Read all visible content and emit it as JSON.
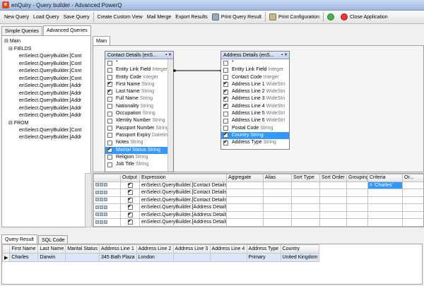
{
  "window": {
    "title": "enQuiry - Query builder - Advanced PowerQ"
  },
  "toolbar": {
    "new_query": "New Query",
    "load_query": "Load Query",
    "save_query": "Save Query",
    "create_custom_view": "Create Custom View",
    "mail_merge": "Mail Merge",
    "export_results": "Export Results",
    "print_query_result": "Print Query Result",
    "print_configuration": "Print Configuration",
    "close_application": "Close Application"
  },
  "tabs": {
    "simple": "Simple Queries",
    "advanced": "Advanced Queries",
    "main": "Main"
  },
  "tree": {
    "root": "Main",
    "fields": "FIELDS",
    "field_items": [
      "enSelect.QueryBuilder.[Cont",
      "enSelect.QueryBuilder.[Cont",
      "enSelect.QueryBuilder.[Cont",
      "enSelect.QueryBuilder.[Cont",
      "enSelect.QueryBuilder.[Addr",
      "enSelect.QueryBuilder.[Addr",
      "enSelect.QueryBuilder.[Addr",
      "enSelect.QueryBuilder.[Addr",
      "enSelect.QueryBuilder.[Addr"
    ],
    "from": "FROM",
    "from_items": [
      "enSelect.QueryBuilder.[Cont",
      "enSelect.QueryBuilder.[Addr"
    ]
  },
  "contact_box": {
    "title": "Contact Details (enS...",
    "rows": [
      {
        "name": "*",
        "type": "",
        "checked": false,
        "selected": false
      },
      {
        "name": "Entity Link Field",
        "type": "Integer",
        "checked": false,
        "selected": false
      },
      {
        "name": "Entity Code",
        "type": "Integer",
        "checked": false,
        "selected": false
      },
      {
        "name": "First Name",
        "type": "String",
        "checked": true,
        "selected": false
      },
      {
        "name": "Last Name",
        "type": "String",
        "checked": true,
        "selected": false
      },
      {
        "name": "Full Name",
        "type": "String",
        "checked": false,
        "selected": false
      },
      {
        "name": "Nationality",
        "type": "String",
        "checked": false,
        "selected": false
      },
      {
        "name": "Occupation",
        "type": "String",
        "checked": false,
        "selected": false
      },
      {
        "name": "Identity Number",
        "type": "String",
        "checked": false,
        "selected": false
      },
      {
        "name": "Passport Number",
        "type": "String",
        "checked": false,
        "selected": false
      },
      {
        "name": "Passport Expiry",
        "type": "Datetime",
        "checked": false,
        "selected": false
      },
      {
        "name": "Notes",
        "type": "String",
        "checked": false,
        "selected": false
      },
      {
        "name": "Marital Status",
        "type": "String",
        "checked": true,
        "selected": true
      },
      {
        "name": "Religion",
        "type": "String",
        "checked": false,
        "selected": false
      },
      {
        "name": "Job Title",
        "type": "String",
        "checked": false,
        "selected": false
      }
    ]
  },
  "address_box": {
    "title": "Address Details (enS...",
    "rows": [
      {
        "name": "*",
        "type": "",
        "checked": false,
        "selected": false
      },
      {
        "name": "Entity Link Field",
        "type": "Integer",
        "checked": false,
        "selected": false
      },
      {
        "name": "Contact Code",
        "type": "Integer",
        "checked": false,
        "selected": false
      },
      {
        "name": "Address Line 1",
        "type": "WideStri",
        "checked": true,
        "selected": false
      },
      {
        "name": "Address Line 2",
        "type": "WideStri",
        "checked": true,
        "selected": false
      },
      {
        "name": "Address Line 3",
        "type": "WideStri",
        "checked": true,
        "selected": false
      },
      {
        "name": "Address Line 4",
        "type": "WideStri",
        "checked": true,
        "selected": false
      },
      {
        "name": "Address Line 5",
        "type": "WideStri",
        "checked": false,
        "selected": false
      },
      {
        "name": "Address Line 6",
        "type": "WideStri",
        "checked": false,
        "selected": false
      },
      {
        "name": "Postal Code",
        "type": "String",
        "checked": false,
        "selected": false
      },
      {
        "name": "Country",
        "type": "String",
        "checked": true,
        "selected": true
      },
      {
        "name": "Address Type",
        "type": "String",
        "checked": true,
        "selected": false
      }
    ]
  },
  "query_grid": {
    "headers": [
      "Output",
      "Expression",
      "Aggregate",
      "Alias",
      "Sort Type",
      "Sort Order",
      "Grouping",
      "Criteria",
      "Or..."
    ],
    "rows": [
      {
        "output": true,
        "expression": "enSelect.QueryBuilder.[Contact Details]",
        "criteria": "= 'Charles'"
      },
      {
        "output": true,
        "expression": "enSelect.QueryBuilder.[Contact Details]",
        "criteria": ""
      },
      {
        "output": true,
        "expression": "enSelect.QueryBuilder.[Contact Details]",
        "criteria": ""
      },
      {
        "output": true,
        "expression": "enSelect.QueryBuilder.[Address Details]",
        "criteria": ""
      },
      {
        "output": true,
        "expression": "enSelect.QueryBuilder.[Address Details]",
        "criteria": ""
      },
      {
        "output": true,
        "expression": "enSelect.QueryBuilder.[Address Details]",
        "criteria": ""
      }
    ]
  },
  "bottom_tabs": {
    "query_result": "Query Result",
    "sql_code": "SQL Code"
  },
  "result": {
    "headers": [
      "First Name",
      "Last Name",
      "Marital Status",
      "Address Line 1",
      "Address Line 2",
      "Address Line 3",
      "Address Line 4",
      "Address Type",
      "Country"
    ],
    "rows": [
      [
        "Charles",
        "Darwin",
        "",
        "345 Bath Plaza",
        "London",
        "",
        "",
        "Primary",
        "United Kingdom"
      ]
    ]
  },
  "colors": {
    "selection": "#3399ff",
    "title_bar": "#b4c9e8"
  }
}
